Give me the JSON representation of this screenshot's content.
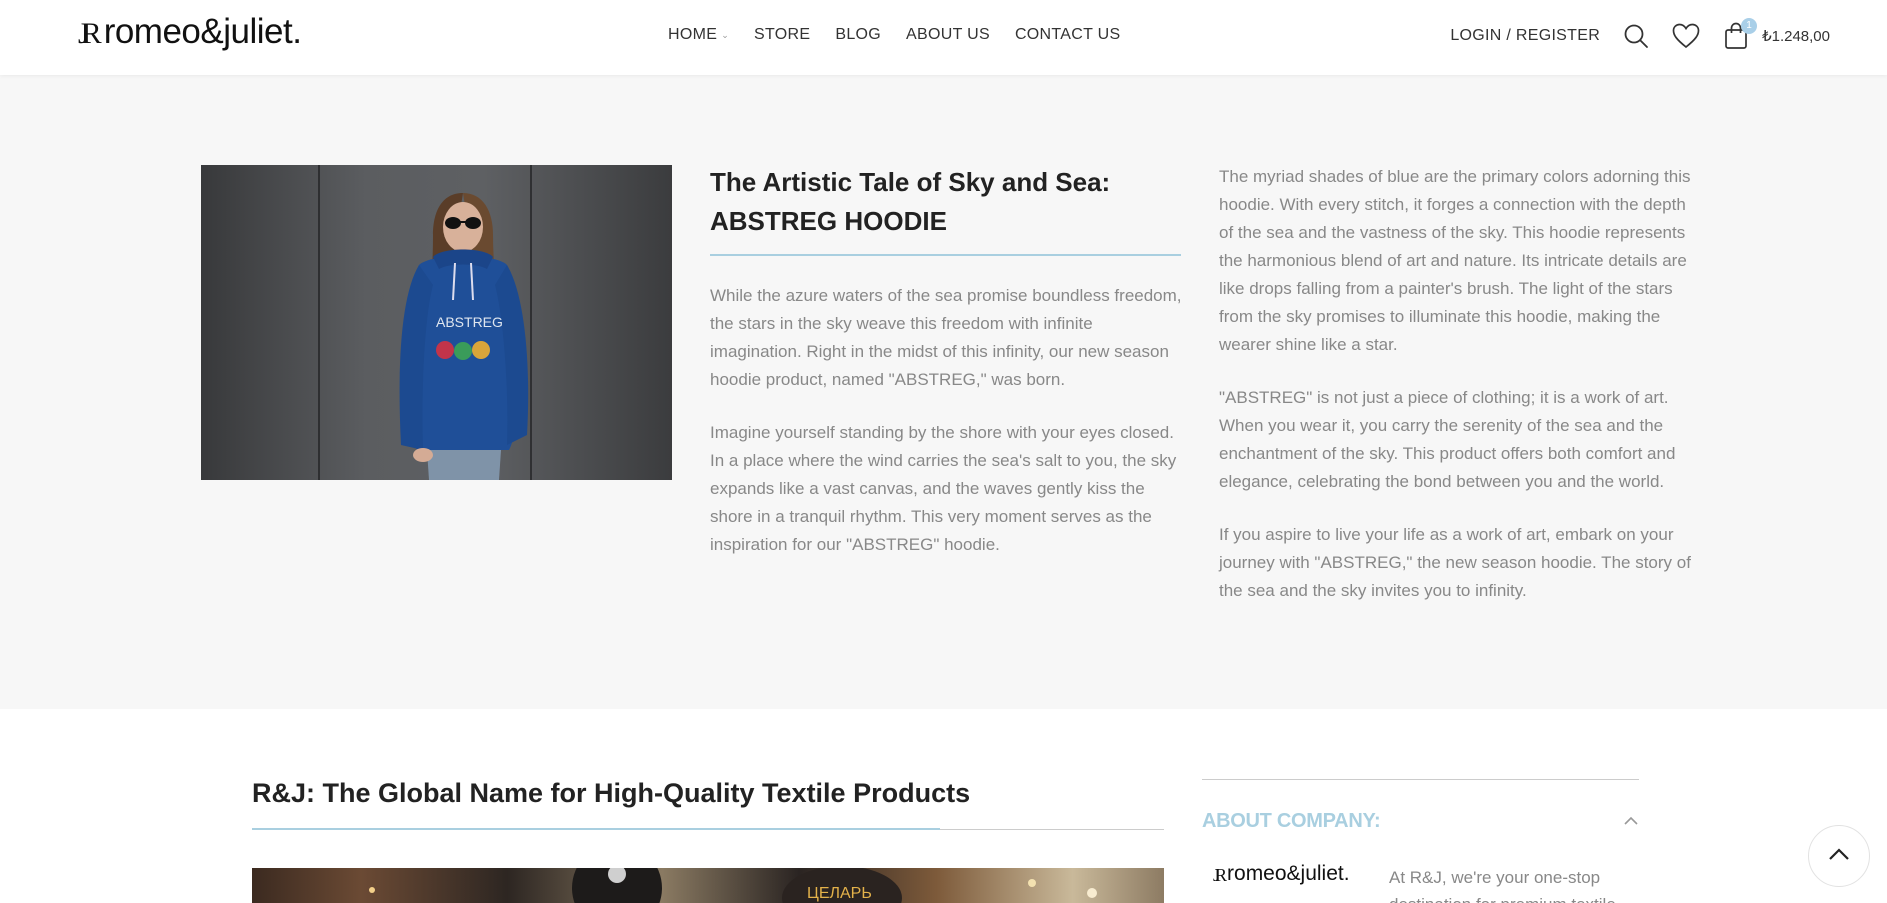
{
  "header": {
    "logo_mark": "JR",
    "logo_text": "romeo&juliet.",
    "nav": [
      "HOME",
      "STORE",
      "BLOG",
      "ABOUT US",
      "CONTACT US"
    ],
    "login": "LOGIN / REGISTER",
    "cart_count": "1",
    "cart_total": "₺1.248,00",
    "icons": [
      "search-icon",
      "heart-icon",
      "shopping-bag-icon"
    ]
  },
  "feature": {
    "title": "The Artistic Tale of Sky and Sea: ABSTREG HOODIE",
    "image_alt": "Woman wearing blue ABSTREG hoodie",
    "middle_paragraphs": [
      "While the azure waters of the sea promise boundless freedom, the stars in the sky weave this freedom with infinite imagination. Right in the midst of this infinity, our new season hoodie product, named \"ABSTREG,\" was born.",
      "Imagine yourself standing by the shore with your eyes closed. In a place where the wind carries the sea's salt to you, the sky expands like a vast canvas, and the waves gently kiss the shore in a tranquil rhythm. This very moment serves as the inspiration for our \"ABSTREG\" hoodie."
    ],
    "right_paragraphs": [
      "The myriad shades of blue are the primary colors adorning this hoodie. With every stitch, it forges a connection with the depth of the sea and the vastness of the sky. This hoodie represents the harmonious blend of art and nature. Its intricate details are like drops falling from a painter's brush. The light of the stars from the sky promises to illuminate this hoodie, making the wearer shine like a star.",
      "\"ABSTREG\" is not just a piece of clothing; it is a work of art. When you wear it, you carry the serenity of the sea and the enchantment of the sky. This product offers both comfort and elegance, celebrating the bond between you and the world.",
      "If you aspire to live your life as a work of art, embark on your journey with \"ABSTREG,\" the new season hoodie. The story of the sea and the sky invites you to infinity."
    ]
  },
  "section": {
    "title": "R&J: The Global Name for High-Quality Textile Products"
  },
  "about": {
    "title": "ABOUT COMPANY:",
    "logo_mark": "JR",
    "logo_text": "romeo&juliet.",
    "text": "At R&J, we're your one-stop destination for premium textile"
  },
  "colors": {
    "accent": "#a9cfe0",
    "band_bg": "#f7f7f7",
    "body_text": "#888888",
    "heading": "#222222"
  }
}
